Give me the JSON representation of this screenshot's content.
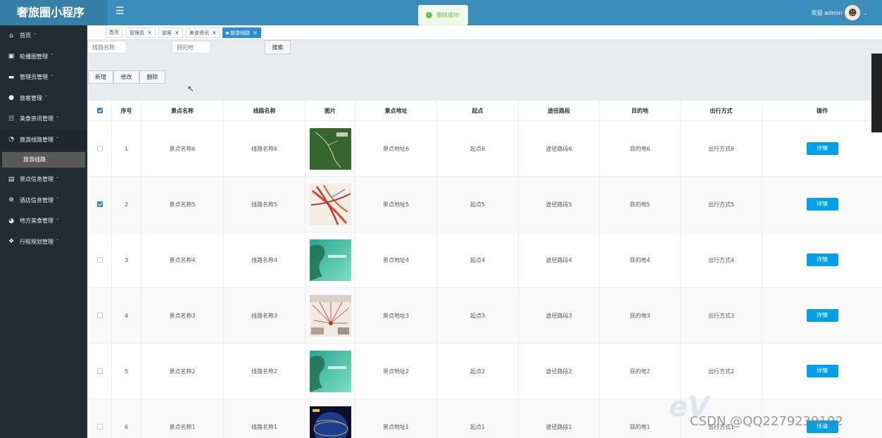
{
  "header": {
    "brand": "奢旅圈小程序",
    "menu_toggle_icon": "hamburger-icon",
    "welcome": "欢迎 admin"
  },
  "toast": {
    "message": "删除成功",
    "icon": "check-circle-icon"
  },
  "sidebar": {
    "items": [
      {
        "label": "首页",
        "icon": "home-icon"
      },
      {
        "label": "轮播图管理",
        "icon": "image-icon"
      },
      {
        "label": "管理员管理",
        "icon": "card-icon"
      },
      {
        "label": "旅客管理",
        "icon": "user-icon"
      },
      {
        "label": "美食资讯管理",
        "icon": "grid-icon"
      },
      {
        "label": "旅游线路管理",
        "icon": "compass-icon",
        "expanded": true
      },
      {
        "label": "景点信息管理",
        "icon": "gift-icon"
      },
      {
        "label": "酒店信息管理",
        "icon": "globe-icon"
      },
      {
        "label": "地方美食管理",
        "icon": "dashboard-icon"
      },
      {
        "label": "行程规划管理",
        "icon": "apps-icon"
      }
    ],
    "sub_active": "旅游线路"
  },
  "tabs": [
    {
      "label": "首页",
      "closable": false
    },
    {
      "label": "管理员",
      "closable": true
    },
    {
      "label": "旅客",
      "closable": true
    },
    {
      "label": "美食资讯",
      "closable": true
    },
    {
      "label": "旅游线路",
      "closable": true,
      "active": true
    }
  ],
  "search": {
    "route_placeholder": "线路名称",
    "dest_placeholder": "目的地",
    "search_label": "搜索"
  },
  "toolbar": {
    "add": "新增",
    "edit": "修改",
    "delete": "删除"
  },
  "table": {
    "headers": [
      "序号",
      "景点名称",
      "线路名称",
      "图片",
      "景点地址",
      "起点",
      "途径路段",
      "目的地",
      "出行方式",
      "操作"
    ],
    "detail_label": "详情",
    "rows": [
      {
        "no": "1",
        "spot": "景点名称6",
        "route": "线路名称6",
        "image": "green-map",
        "address": "景点地址6",
        "start": "起点6",
        "via": "途径路段6",
        "dest": "目的地6",
        "mode": "出行方式6",
        "checked": false
      },
      {
        "no": "2",
        "spot": "景点名称5",
        "route": "线路名称5",
        "image": "route-map",
        "address": "景点地址5",
        "start": "起点5",
        "via": "途径路段5",
        "dest": "目的地5",
        "mode": "出行方式5",
        "checked": true
      },
      {
        "no": "3",
        "spot": "景点名称4",
        "route": "线路名称4",
        "image": "teal-map",
        "address": "景点地址4",
        "start": "起点4",
        "via": "途径路段4",
        "dest": "目的地4",
        "mode": "出行方式4",
        "checked": false
      },
      {
        "no": "4",
        "spot": "景点名称3",
        "route": "线路名称3",
        "image": "radial-map",
        "address": "景点地址3",
        "start": "起点3",
        "via": "途径路段3",
        "dest": "目的地3",
        "mode": "出行方式3",
        "checked": false
      },
      {
        "no": "5",
        "spot": "景点名称2",
        "route": "线路名称2",
        "image": "teal-map",
        "address": "景点地址2",
        "start": "起点2",
        "via": "途径路段2",
        "dest": "目的地2",
        "mode": "出行方式2",
        "checked": false
      },
      {
        "no": "6",
        "spot": "景点名称1",
        "route": "线路名称1",
        "image": "globe-map",
        "address": "景点地址1",
        "start": "起点1",
        "via": "途径路段1",
        "dest": "目的地1",
        "mode": "出行方式1",
        "checked": false
      }
    ]
  },
  "watermark": "CSDN @QQ2279239102",
  "colors": {
    "header": "#3c8dbc",
    "sidebar": "#222d32",
    "tab_active": "#2e8ccf",
    "detail_button": "#00a0e9",
    "toast_text": "#67c23a"
  }
}
